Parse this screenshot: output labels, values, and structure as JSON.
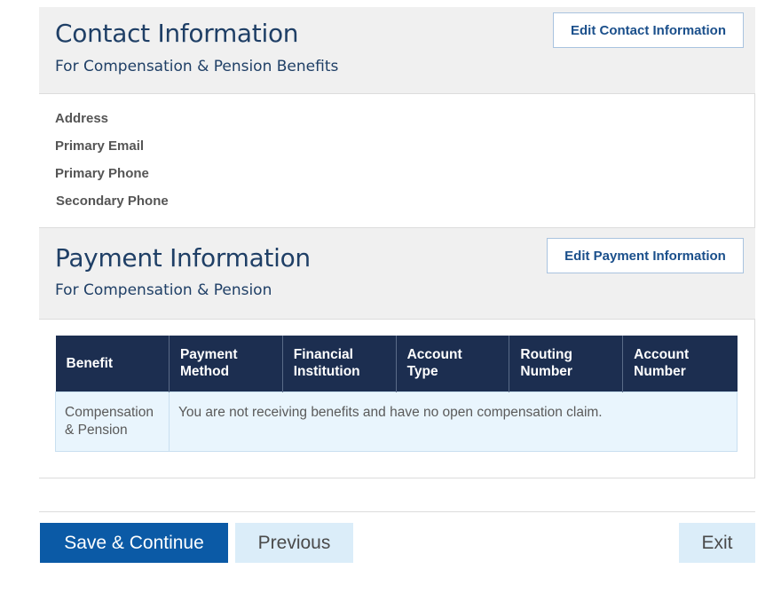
{
  "contact": {
    "title": "Contact Information",
    "subtitle": "For Compensation & Pension Benefits",
    "edit_label": "Edit Contact Information",
    "fields": [
      "Address",
      "Primary Email",
      "Primary Phone",
      "Secondary Phone"
    ]
  },
  "payment": {
    "title": "Payment Information",
    "subtitle": "For Compensation & Pension",
    "edit_label": "Edit Payment Information",
    "table": {
      "headers": [
        [
          "Benefit"
        ],
        [
          "Payment",
          "Method"
        ],
        [
          "Financial",
          "Institution"
        ],
        [
          "Account",
          "Type"
        ],
        [
          "Routing",
          "Number"
        ],
        [
          "Account",
          "Number"
        ]
      ],
      "row": {
        "benefit": [
          "Compensation",
          "& Pension"
        ],
        "message": "You are not receiving benefits and have no open compensation claim."
      }
    }
  },
  "footer": {
    "save_label": "Save & Continue",
    "previous_label": "Previous",
    "exit_label": "Exit"
  }
}
